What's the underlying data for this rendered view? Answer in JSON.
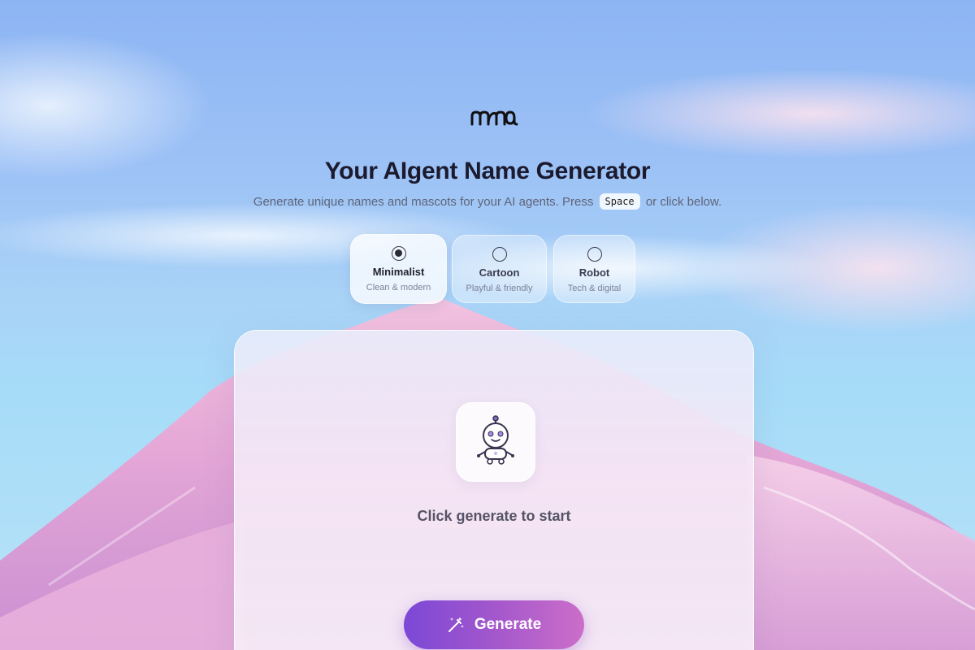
{
  "brand": {
    "logo_text": "nma"
  },
  "header": {
    "title": "Your AIgent Name Generator",
    "subtitle_before": "Generate unique names and mascots for your AI agents. Press",
    "subtitle_key": "Space",
    "subtitle_after": "or click below."
  },
  "styles": {
    "selected": "Minimalist",
    "options": [
      {
        "name": "Minimalist",
        "description": "Clean & modern"
      },
      {
        "name": "Cartoon",
        "description": "Playful & friendly"
      },
      {
        "name": "Robot",
        "description": "Tech & digital"
      }
    ]
  },
  "result": {
    "mascot_icon": "robot-mascot-icon",
    "placeholder": "Click generate to start"
  },
  "actions": {
    "generate_label": "Generate",
    "generate_icon": "magic-wand-icon"
  },
  "colors": {
    "accent_start": "#7b48d6",
    "accent_end": "#cc6ec9",
    "title": "#1b1a2e"
  }
}
